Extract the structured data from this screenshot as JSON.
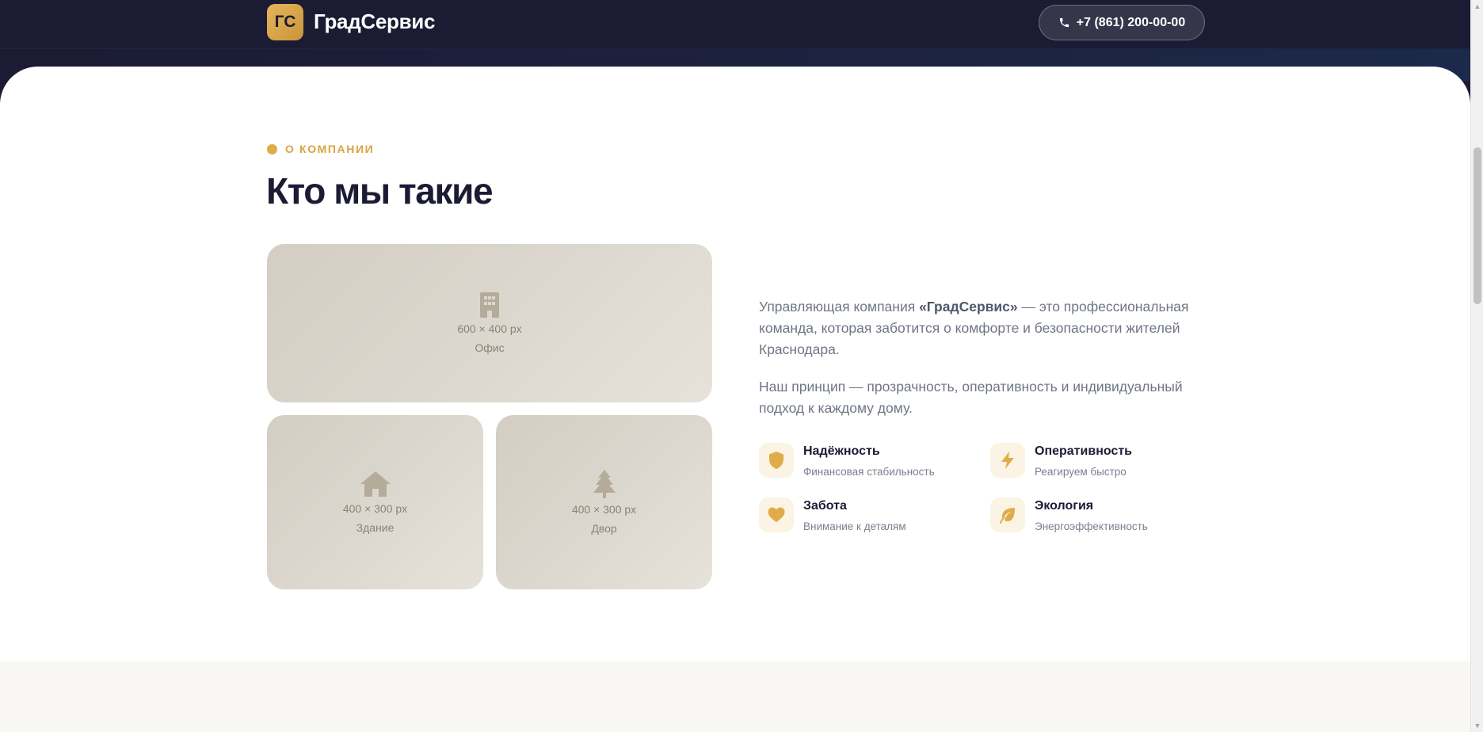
{
  "header": {
    "logo_badge": "ГС",
    "logo_name": "ГрадСервис",
    "phone": "+7 (861) 200-00-00"
  },
  "about": {
    "eyebrow": "О КОМПАНИИ",
    "title": "Кто мы такие",
    "images": [
      {
        "size": "600 × 400 px",
        "label": "Офис",
        "icon": "building-icon"
      },
      {
        "size": "400 × 300 px",
        "label": "Здание",
        "icon": "house-icon"
      },
      {
        "size": "400 × 300 px",
        "label": "Двор",
        "icon": "tree-icon"
      }
    ],
    "intro_prefix": "Управляющая компания ",
    "intro_company": "«ГрадСервис»",
    "intro_suffix": " — это профессиональная команда, которая заботится о комфорте и безопасности жителей Краснодара.",
    "principle": "Наш принцип — прозрачность, оперативность и индивидуальный подход к каждому дому.",
    "features": [
      {
        "title": "Надёжность",
        "subtitle": "Финансовая стабильность",
        "icon": "shield-icon"
      },
      {
        "title": "Оперативность",
        "subtitle": "Реагируем быстро",
        "icon": "lightning-icon"
      },
      {
        "title": "Забота",
        "subtitle": "Внимание к деталям",
        "icon": "heart-icon"
      },
      {
        "title": "Экология",
        "subtitle": "Энергоэффективность",
        "icon": "leaf-icon"
      }
    ]
  },
  "colors": {
    "navy": "#1b1b33",
    "accent": "#e0ac49",
    "placeholder": "#d8d2c9",
    "muted_text": "#6f7585"
  }
}
